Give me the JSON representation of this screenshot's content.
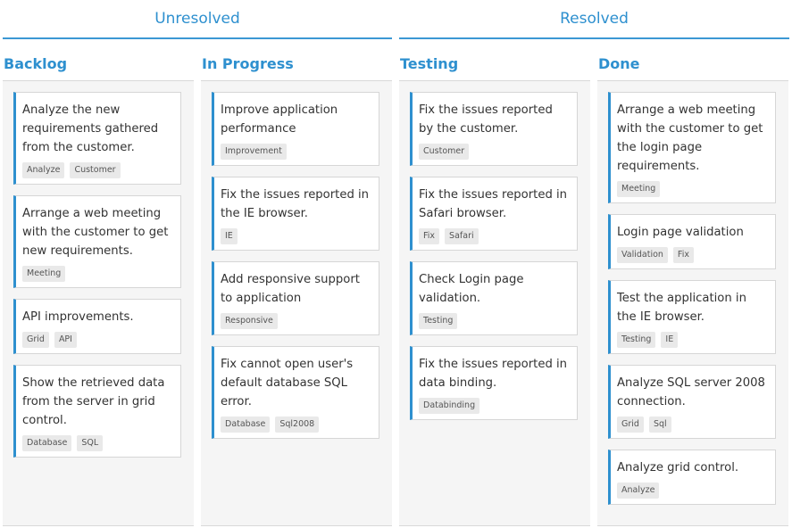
{
  "groups": {
    "unresolved": "Unresolved",
    "resolved": "Resolved"
  },
  "columns": [
    {
      "title": "Backlog",
      "cards": [
        {
          "text": "Analyze the new requirements gathered from the customer.",
          "tags": [
            "Analyze",
            "Customer"
          ]
        },
        {
          "text": "Arrange a web meeting with the customer to get new requirements.",
          "tags": [
            "Meeting"
          ]
        },
        {
          "text": "API improvements.",
          "tags": [
            "Grid",
            "API"
          ]
        },
        {
          "text": "Show the retrieved data from the server in grid control.",
          "tags": [
            "Database",
            "SQL"
          ]
        }
      ]
    },
    {
      "title": "In Progress",
      "cards": [
        {
          "text": "Improve application performance",
          "tags": [
            "Improvement"
          ]
        },
        {
          "text": "Fix the issues reported in the IE browser.",
          "tags": [
            "IE"
          ]
        },
        {
          "text": "Add responsive support to application",
          "tags": [
            "Responsive"
          ]
        },
        {
          "text": "Fix cannot open user's default database SQL error.",
          "tags": [
            "Database",
            "Sql2008"
          ]
        }
      ]
    },
    {
      "title": "Testing",
      "cards": [
        {
          "text": "Fix the issues reported by the customer.",
          "tags": [
            "Customer"
          ]
        },
        {
          "text": "Fix the issues reported in Safari browser.",
          "tags": [
            "Fix",
            "Safari"
          ]
        },
        {
          "text": "Check Login page validation.",
          "tags": [
            "Testing"
          ]
        },
        {
          "text": "Fix the issues reported in data binding.",
          "tags": [
            "Databinding"
          ]
        }
      ]
    },
    {
      "title": "Done",
      "cards": [
        {
          "text": "Arrange a web meeting with the customer to get the login page requirements.",
          "tags": [
            "Meeting"
          ]
        },
        {
          "text": "Login page validation",
          "tags": [
            "Validation",
            "Fix"
          ]
        },
        {
          "text": "Test the application in the IE browser.",
          "tags": [
            "Testing",
            "IE"
          ]
        },
        {
          "text": "Analyze SQL server 2008 connection.",
          "tags": [
            "Grid",
            "Sql"
          ]
        },
        {
          "text": "Analyze grid control.",
          "tags": [
            "Analyze"
          ]
        }
      ]
    }
  ],
  "colors": {
    "accent": "#2e90cf",
    "column_bg": "#f5f5f5",
    "tag_bg": "#e9e9e9"
  }
}
